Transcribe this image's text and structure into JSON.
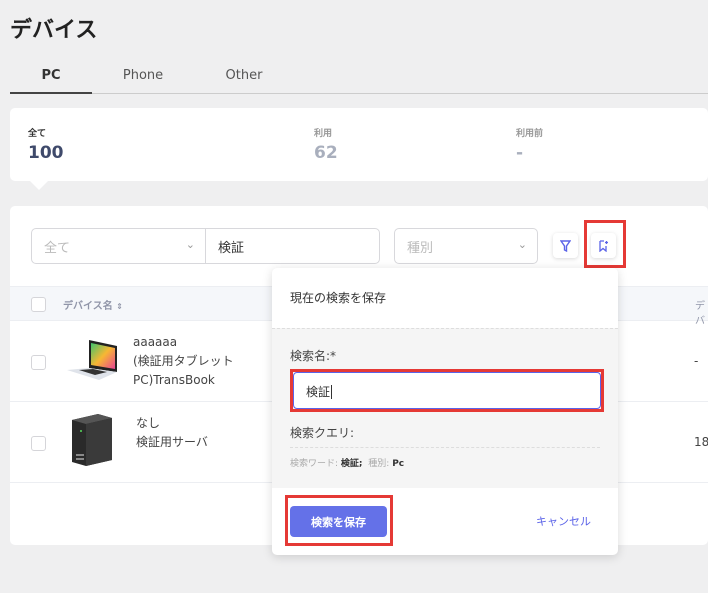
{
  "page": {
    "title": "デバイス"
  },
  "tabs": [
    {
      "label": "PC",
      "active": true
    },
    {
      "label": "Phone"
    },
    {
      "label": "Other"
    }
  ],
  "stats": [
    {
      "label": "全て",
      "value": "100"
    },
    {
      "label": "利用",
      "value": "62"
    },
    {
      "label": "利用前",
      "value": "-"
    }
  ],
  "filters": {
    "scope": "全て",
    "keyword": "検証",
    "type_placeholder": "種別"
  },
  "table": {
    "headers": [
      "デバイス名",
      "デバ"
    ],
    "rows": [
      {
        "name_lines": [
          "aaaaaa",
          "(検証用タブレット",
          "PC)TransBook"
        ],
        "icon": "laptop-icon",
        "col2": "-"
      },
      {
        "name_lines": [
          "なし",
          "検証用サーバ"
        ],
        "icon": "server-tower-icon",
        "col2": "18"
      }
    ]
  },
  "popup": {
    "title": "現在の検索を保存",
    "name_label": "検索名:*",
    "name_value": "検証",
    "query_label": "検索クエリ:",
    "query": {
      "word_label": "検索ワード:",
      "word_value": "検証;",
      "type_label": "種別:",
      "type_value": "Pc"
    },
    "save_label": "検索を保存",
    "cancel_label": "キャンセル"
  },
  "colors": {
    "accent": "#5b63e8",
    "highlight": "#e53935"
  }
}
